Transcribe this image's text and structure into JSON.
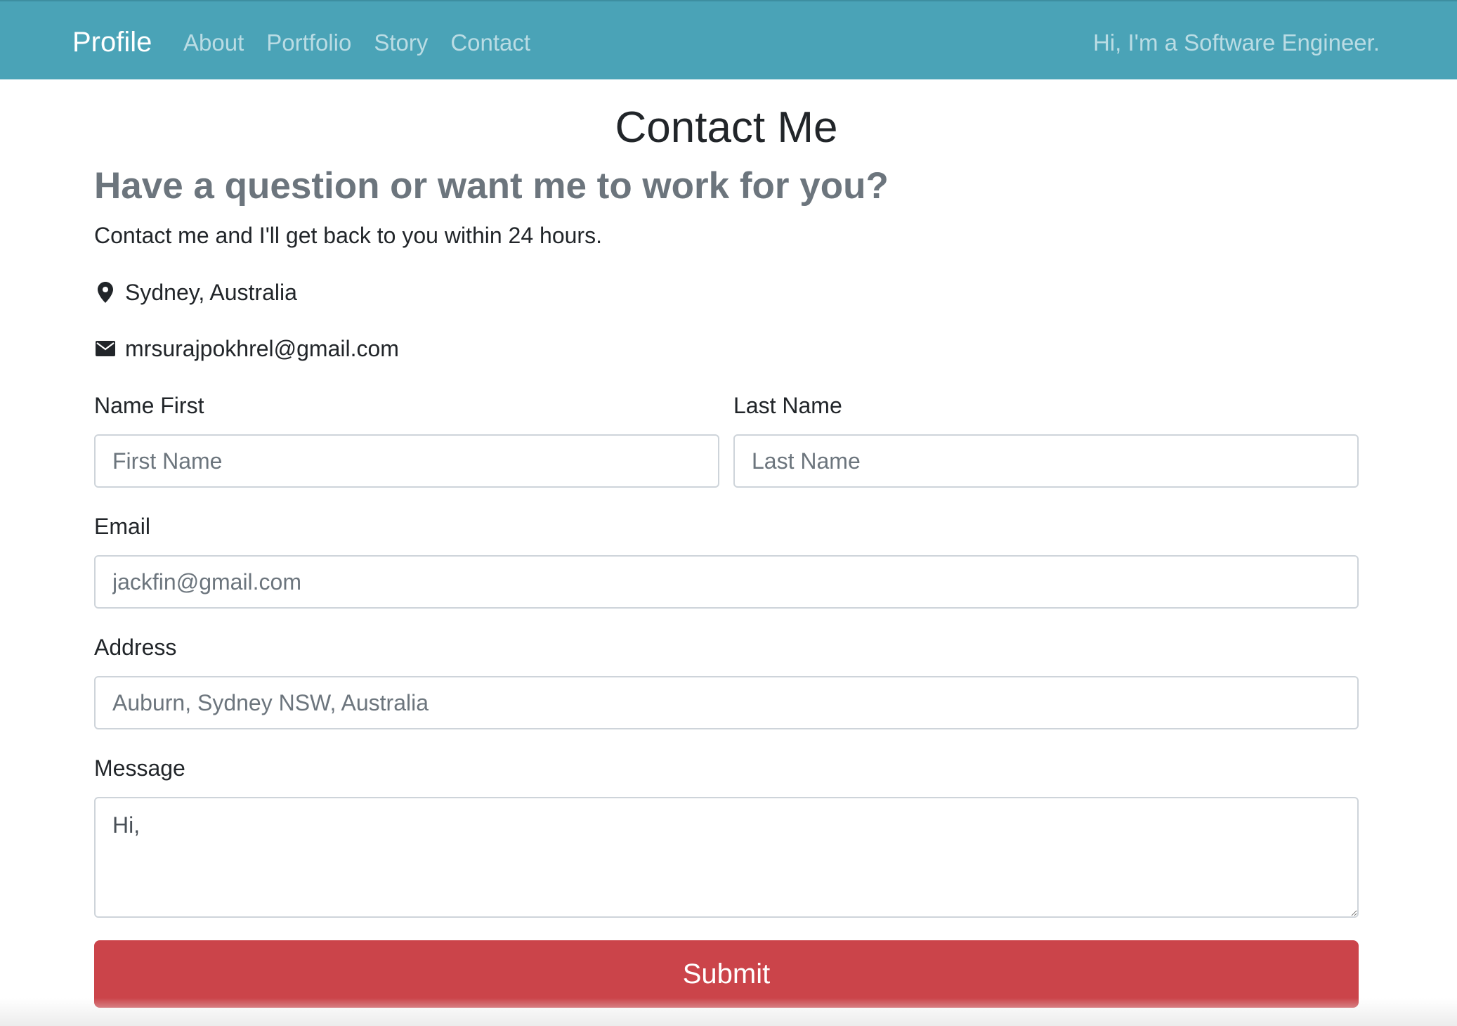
{
  "navbar": {
    "brand": "Profile",
    "links": [
      "About",
      "Portfolio",
      "Story",
      "Contact"
    ],
    "tagline": "Hi, I'm a Software Engineer.",
    "background_color": "#4aa3b7"
  },
  "main": {
    "title": "Contact Me",
    "subtitle": "Have a question or want me to work for you?",
    "intro": "Contact me and I'll get back to you within 24 hours.",
    "location": {
      "icon": "map-pin-icon",
      "text": "Sydney, Australia"
    },
    "email": {
      "icon": "envelope-icon",
      "text": "mrsurajpokhrel@gmail.com"
    }
  },
  "form": {
    "first_name": {
      "label": "Name First",
      "placeholder": "First Name",
      "value": ""
    },
    "last_name": {
      "label": "Last Name",
      "placeholder": "Last Name",
      "value": ""
    },
    "email": {
      "label": "Email",
      "placeholder": "jackfin@gmail.com",
      "value": ""
    },
    "address": {
      "label": "Address",
      "placeholder": "Auburn, Sydney NSW, Australia",
      "value": ""
    },
    "message": {
      "label": "Message",
      "value": "Hi,"
    },
    "submit_label": "Submit",
    "submit_color": "#cb444a"
  }
}
